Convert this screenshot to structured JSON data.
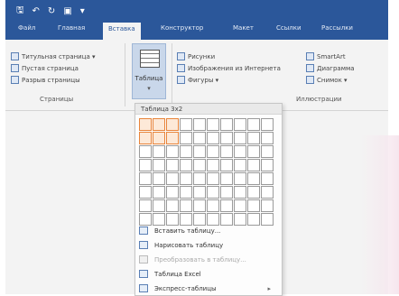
{
  "titlebar": {
    "qat_icons": [
      "save-icon",
      "undo-icon",
      "redo-icon",
      "view-icon",
      "dropdown-icon"
    ],
    "save_glyph": "🖫",
    "undo_glyph": "↶",
    "redo_glyph": "↻",
    "view_glyph": "▣",
    "more_glyph": "▾"
  },
  "tabs": [
    {
      "label": "Файл"
    },
    {
      "label": "Главная"
    },
    {
      "label": "Вставка",
      "active": true
    },
    {
      "label": "Конструктор"
    },
    {
      "label": "Макет"
    },
    {
      "label": "Ссылки"
    },
    {
      "label": "Рассылки"
    }
  ],
  "ribbon": {
    "pages": {
      "items": [
        "Титульная страница ▾",
        "Пустая страница",
        "Разрыв страницы"
      ],
      "label": "Страницы"
    },
    "table_button": {
      "label": "Таблица",
      "chevron": "▾"
    },
    "illustrations": {
      "col1": [
        "Рисунки",
        "Изображения из Интернета",
        "Фигуры ▾"
      ],
      "col2": [
        "SmartArt",
        "Диаграмма",
        "Снимок ▾"
      ],
      "label": "Иллюстрации"
    }
  },
  "dropdown": {
    "header": "Таблица 3x2",
    "grid_cols": 10,
    "grid_rows": 8,
    "selected_cols": 3,
    "selected_rows": 2,
    "menu": [
      {
        "label": "Вставить таблицу...",
        "disabled": false
      },
      {
        "label": "Нарисовать таблицу",
        "disabled": false
      },
      {
        "label": "Преобразовать в таблицу...",
        "disabled": true
      },
      {
        "label": "Таблица Excel",
        "disabled": false
      },
      {
        "label": "Экспресс-таблицы",
        "disabled": false,
        "submenu": "▸"
      }
    ]
  },
  "colors": {
    "accent": "#2b579a",
    "selection": "#e8843a"
  }
}
